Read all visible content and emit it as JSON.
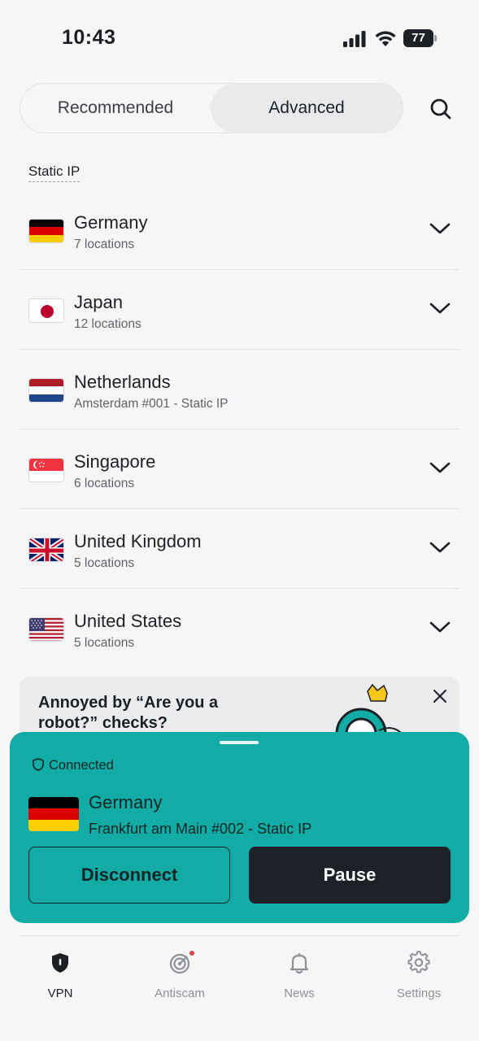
{
  "status_bar": {
    "time": "10:43",
    "battery": "77"
  },
  "segmented": {
    "left": "Recommended",
    "right": "Advanced",
    "selected": "Advanced"
  },
  "section": {
    "label": "Static IP"
  },
  "locations": [
    {
      "name": "Germany",
      "sub": "7 locations",
      "flag": "germany-flag",
      "expandable": true
    },
    {
      "name": "Japan",
      "sub": "12 locations",
      "flag": "japan-flag",
      "expandable": true
    },
    {
      "name": "Netherlands",
      "sub": "Amsterdam #001 - Static IP",
      "flag": "netherlands-flag",
      "expandable": false
    },
    {
      "name": "Singapore",
      "sub": "6 locations",
      "flag": "singapore-flag",
      "expandable": true
    },
    {
      "name": "United Kingdom",
      "sub": "5 locations",
      "flag": "uk-flag",
      "expandable": true
    },
    {
      "name": "United States",
      "sub": "5 locations",
      "flag": "us-flag",
      "expandable": true
    }
  ],
  "promo": {
    "text": "Annoyed by “Are you a robot?” checks?"
  },
  "connection": {
    "status": "Connected",
    "country": "Germany",
    "location": "Frankfurt am Main #002 - Static IP",
    "disconnect_label": "Disconnect",
    "pause_label": "Pause",
    "accent": "#12aba6"
  },
  "tabs": [
    {
      "label": "VPN",
      "icon": "shield-icon",
      "active": true
    },
    {
      "label": "Antiscam",
      "icon": "target-icon",
      "active": false,
      "badge": true
    },
    {
      "label": "News",
      "icon": "bell-icon",
      "active": false
    },
    {
      "label": "Settings",
      "icon": "gear-icon",
      "active": false
    }
  ]
}
